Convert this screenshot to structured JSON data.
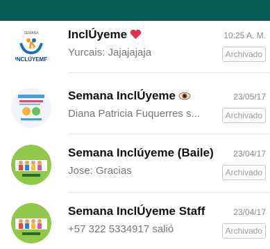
{
  "colors": {
    "header": "#075e54"
  },
  "chats": [
    {
      "title": "InclÚyeme",
      "emoji_icon": "red-heart-icon",
      "subtitle": "Yurcais: Jajajajaja",
      "time": "10:25 A. M.",
      "badge": "Archivado",
      "avatar_icon": "semana-incluyeme-logo"
    },
    {
      "title": "Semana InclÚyeme",
      "emoji_icon": "eye-icon",
      "subtitle": "Diana Patricia Fuquerres s...",
      "time": "23/05/17",
      "badge": "Archivado",
      "avatar_icon": "poster-avatar"
    },
    {
      "title": "Semana Inclúyeme (Baile)",
      "subtitle": "Jose: Gracias",
      "time": "23/04/17",
      "badge": "Archivado",
      "avatar_icon": "kids-group-avatar"
    },
    {
      "title": "Semana InclÚyeme Staff",
      "subtitle": "+57 322 5334917 salió",
      "time": "23/04/17",
      "badge": "Archivado",
      "avatar_icon": "kids-group-avatar"
    }
  ]
}
